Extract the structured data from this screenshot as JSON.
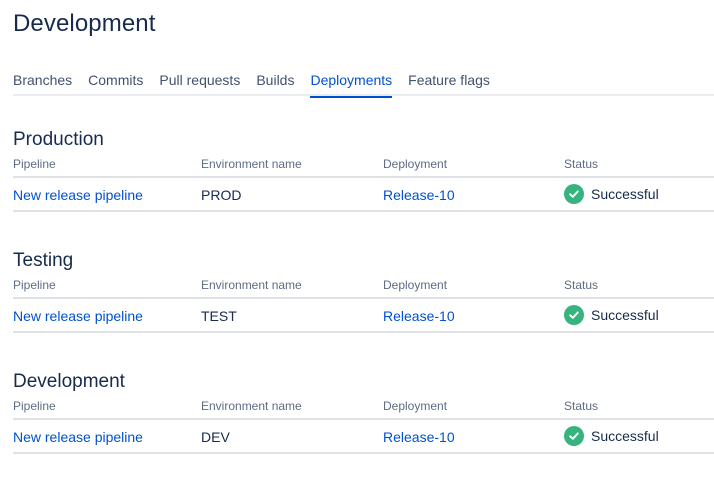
{
  "page": {
    "title": "Development"
  },
  "tabs": [
    {
      "label": "Branches"
    },
    {
      "label": "Commits"
    },
    {
      "label": "Pull requests"
    },
    {
      "label": "Builds"
    },
    {
      "label": "Deployments",
      "active": true
    },
    {
      "label": "Feature flags"
    }
  ],
  "columns": {
    "pipeline": "Pipeline",
    "environment": "Environment name",
    "deployment": "Deployment",
    "status": "Status"
  },
  "sections": [
    {
      "title": "Production",
      "row": {
        "pipeline": "New release pipeline",
        "environment": "PROD",
        "deployment": "Release-10",
        "status": "Successful",
        "status_icon": "check-circle-icon"
      }
    },
    {
      "title": "Testing",
      "row": {
        "pipeline": "New release pipeline",
        "environment": "TEST",
        "deployment": "Release-10",
        "status": "Successful",
        "status_icon": "check-circle-icon"
      }
    },
    {
      "title": "Development",
      "row": {
        "pipeline": "New release pipeline",
        "environment": "DEV",
        "deployment": "Release-10",
        "status": "Successful",
        "status_icon": "check-circle-icon"
      }
    }
  ],
  "colors": {
    "link": "#0052cc",
    "success": "#36b37e",
    "text": "#172b4d",
    "muted": "#5e6c84"
  }
}
